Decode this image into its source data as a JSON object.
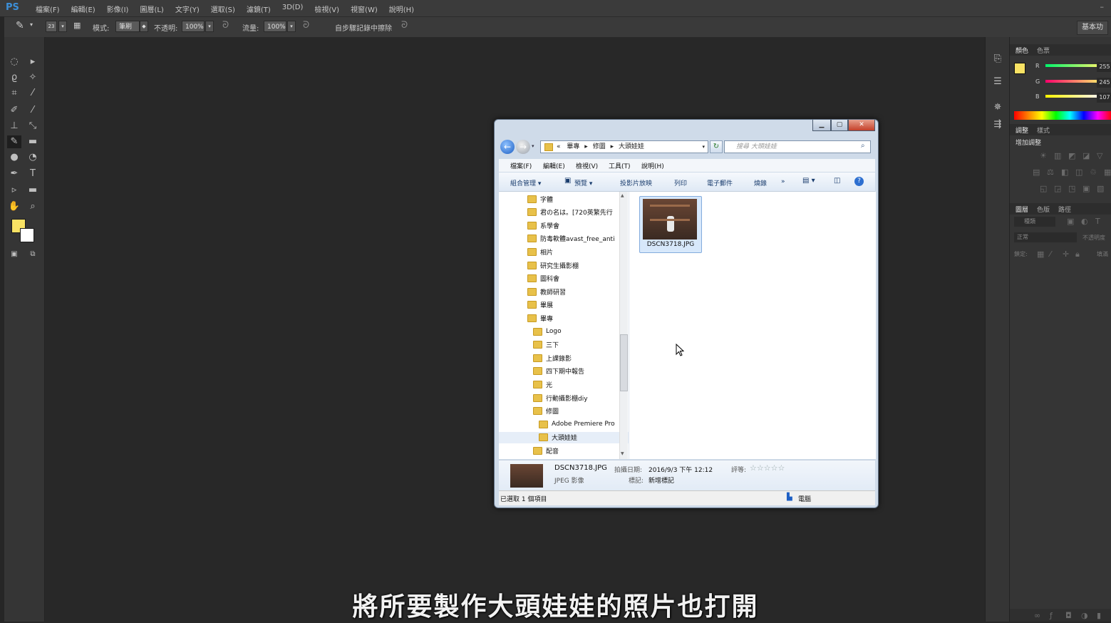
{
  "app": {
    "logo": "PS",
    "menu": [
      "檔案(F)",
      "編輯(E)",
      "影像(I)",
      "圖層(L)",
      "文字(Y)",
      "選取(S)",
      "濾鏡(T)",
      "3D(D)",
      "檢視(V)",
      "視窗(W)",
      "說明(H)"
    ],
    "options": {
      "mode_label": "模式:",
      "mode_value": "筆刷",
      "opacity_label": "不透明:",
      "opacity_value": "100%",
      "flow_label": "流量:",
      "flow_value": "100%",
      "erase_history_label": "自步驟記錄中擦除",
      "brush_size": "23",
      "workspace": "基本功"
    },
    "colors": {
      "foreground": "#f8e264",
      "background": "#ffffff"
    }
  },
  "right_panel": {
    "color_tabs": [
      "顏色",
      "色票"
    ],
    "rgb": [
      {
        "label": "R",
        "value": "255"
      },
      {
        "label": "G",
        "value": "245"
      },
      {
        "label": "B",
        "value": "107"
      }
    ],
    "adjust_tabs": [
      "調整",
      "樣式"
    ],
    "adjust_title": "增加調整",
    "layer_tabs": [
      "圖層",
      "色版",
      "路徑"
    ],
    "layer_kind": "種類",
    "blend_mode": "正常",
    "opacity_label": "不透明度",
    "lock_label": "鎖定:",
    "fill_label": "填滿"
  },
  "explorer": {
    "breadcrumb": [
      "«",
      "畢專",
      "修圖",
      "大頭娃娃"
    ],
    "search_placeholder": "搜尋 大頭娃娃",
    "menu": [
      "檔案(F)",
      "編輯(E)",
      "檢視(V)",
      "工具(T)",
      "說明(H)"
    ],
    "commands": [
      "組合管理 ▾",
      "預覽 ▾",
      "投影片放映",
      "列印",
      "電子郵件",
      "燒錄",
      "»"
    ],
    "folders": [
      {
        "label": "字體",
        "indent": 0
      },
      {
        "label": "君の名は。[720英繁先行",
        "indent": 0
      },
      {
        "label": "系學會",
        "indent": 0
      },
      {
        "label": "防毒軟體avast_free_anti",
        "indent": 0
      },
      {
        "label": "相片",
        "indent": 0
      },
      {
        "label": "研究生攝影棚",
        "indent": 0
      },
      {
        "label": "圖科會",
        "indent": 0
      },
      {
        "label": "教師研習",
        "indent": 0
      },
      {
        "label": "畢展",
        "indent": 0
      },
      {
        "label": "畢專",
        "indent": 0
      },
      {
        "label": "Logo",
        "indent": 1
      },
      {
        "label": "三下",
        "indent": 1
      },
      {
        "label": "上課錄影",
        "indent": 1
      },
      {
        "label": "四下期中報告",
        "indent": 1
      },
      {
        "label": "光",
        "indent": 1
      },
      {
        "label": "行動攝影棚diy",
        "indent": 1
      },
      {
        "label": "修圖",
        "indent": 1
      },
      {
        "label": "Adobe Premiere Pro",
        "indent": 2
      },
      {
        "label": "大頭娃娃",
        "indent": 2,
        "selected": true
      },
      {
        "label": "配音",
        "indent": 1
      }
    ],
    "file": {
      "name": "DSCN3718.JPG"
    },
    "details": {
      "filename": "DSCN3718.JPG",
      "type": "JPEG 影像",
      "date_label": "拍攝日期:",
      "date_value": "2016/9/3 下午 12:12",
      "tag_label": "標記:",
      "tag_value": "新增標記",
      "rating_label": "評等:",
      "rating_value": 0
    },
    "status": "已選取 1 個項目",
    "computer": "電腦"
  },
  "subtitle": "將所要製作大頭娃娃的照片也打開"
}
